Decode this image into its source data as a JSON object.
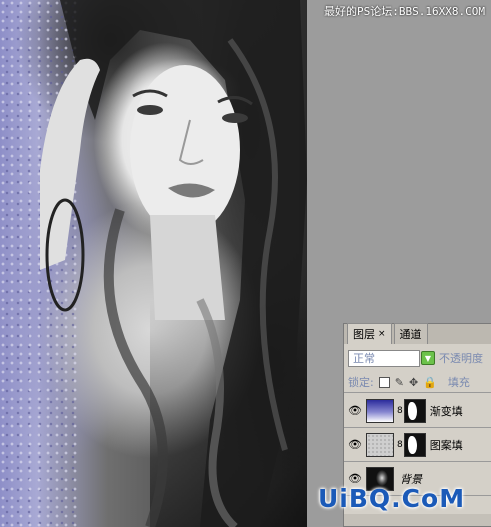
{
  "watermark": "最好的PS论坛:BBS.16XX8.COM",
  "layers_panel": {
    "tabs": [
      {
        "label": "图层",
        "close": "×",
        "active": true
      },
      {
        "label": "通道",
        "active": false
      }
    ],
    "blend_mode": "正常",
    "opacity_label": "不透明度",
    "lock_label": "锁定:",
    "fill_label": "填充",
    "layers": [
      {
        "name": "渐变填",
        "visible": true
      },
      {
        "name": "图案填",
        "visible": true
      },
      {
        "name": "背景",
        "visible": true
      }
    ]
  },
  "logo": "UiBQ.CoM",
  "icons": {
    "eye": "eye-icon",
    "link": "chain-link-icon",
    "brush": "brush-icon",
    "move": "move-icon",
    "lock": "lock-icon",
    "transparency": "lock-transparency-icon"
  }
}
